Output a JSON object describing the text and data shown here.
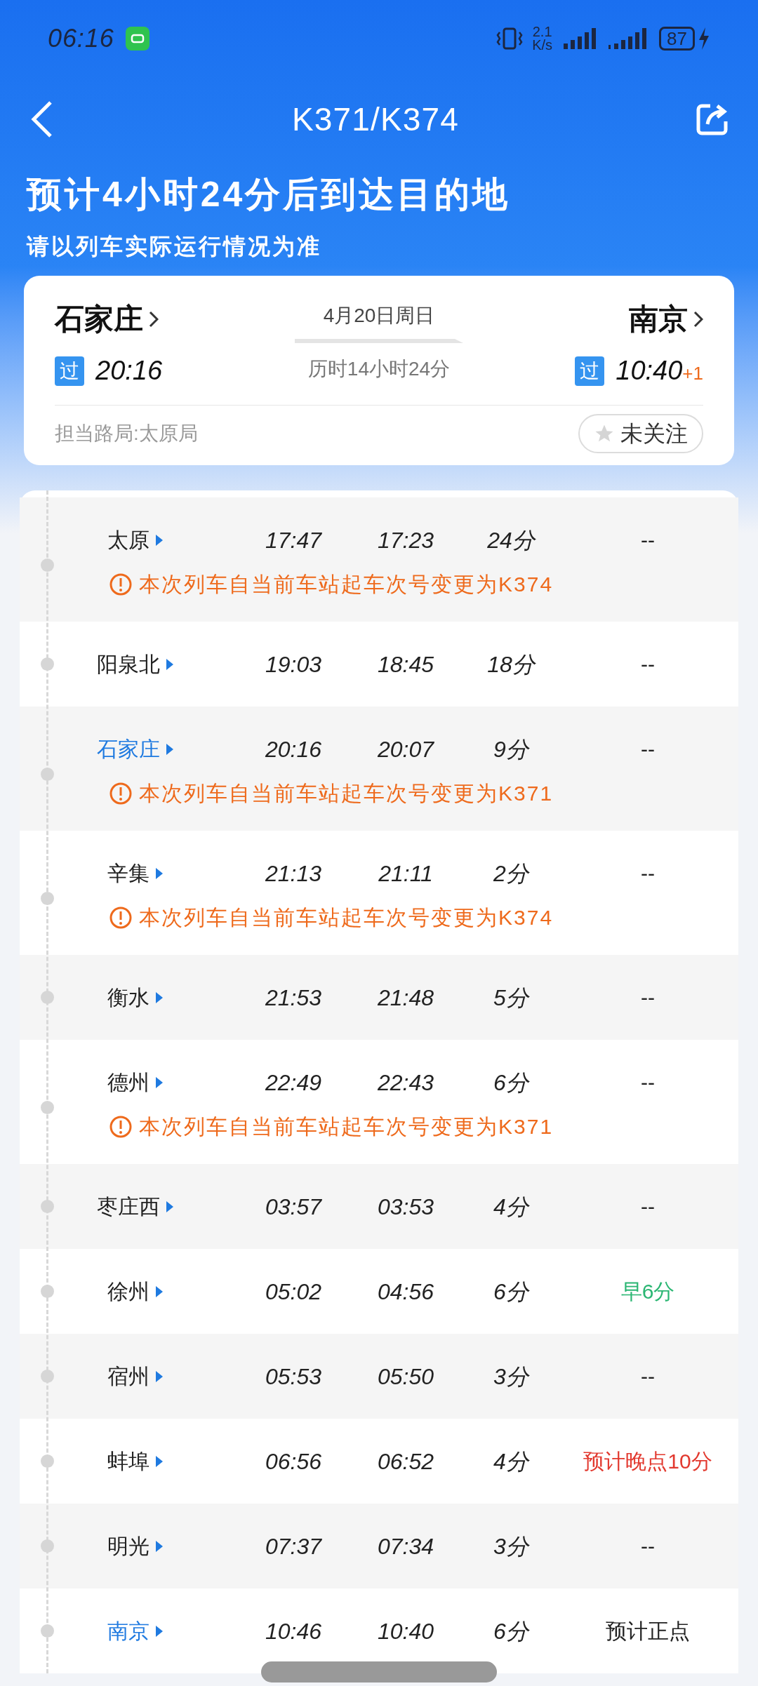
{
  "status_bar": {
    "time": "06:16",
    "net_speed_value": "2.1",
    "net_speed_unit": "K/s",
    "battery": "87"
  },
  "header": {
    "title": "K371/K374"
  },
  "banner": {
    "headline": "预计4小时24分后到达目的地",
    "note": "请以列车实际运行情况为准"
  },
  "trip": {
    "from": "石家庄",
    "from_badge": "过",
    "from_time": "20:16",
    "date": "4月20日周日",
    "duration": "历时14小时24分",
    "to": "南京",
    "to_badge": "过",
    "to_time": "10:40",
    "to_day_offset": "+1",
    "bureau": "担当路局:太原局",
    "follow": {
      "label": "未关注",
      "followed": false
    }
  },
  "stops": [
    {
      "station": "太原",
      "highlighted": false,
      "arrive": "17:47",
      "depart": "17:23",
      "stay": "24分",
      "status": {
        "text": "--",
        "color": "#222222"
      },
      "notice": "本次列车自当前车站起车次号变更为K374"
    },
    {
      "station": "阳泉北",
      "highlighted": false,
      "arrive": "19:03",
      "depart": "18:45",
      "stay": "18分",
      "status": {
        "text": "--",
        "color": "#222222"
      }
    },
    {
      "station": "石家庄",
      "highlighted": true,
      "arrive": "20:16",
      "depart": "20:07",
      "stay": "9分",
      "status": {
        "text": "--",
        "color": "#222222"
      },
      "notice": "本次列车自当前车站起车次号变更为K371"
    },
    {
      "station": "辛集",
      "highlighted": false,
      "arrive": "21:13",
      "depart": "21:11",
      "stay": "2分",
      "status": {
        "text": "--",
        "color": "#222222"
      },
      "notice": "本次列车自当前车站起车次号变更为K374"
    },
    {
      "station": "衡水",
      "highlighted": false,
      "arrive": "21:53",
      "depart": "21:48",
      "stay": "5分",
      "status": {
        "text": "--",
        "color": "#222222"
      }
    },
    {
      "station": "德州",
      "highlighted": false,
      "arrive": "22:49",
      "depart": "22:43",
      "stay": "6分",
      "status": {
        "text": "--",
        "color": "#222222"
      },
      "notice": "本次列车自当前车站起车次号变更为K371"
    },
    {
      "station": "枣庄西",
      "highlighted": false,
      "arrive": "03:57",
      "depart": "03:53",
      "stay": "4分",
      "status": {
        "text": "--",
        "color": "#222222"
      }
    },
    {
      "station": "徐州",
      "highlighted": false,
      "arrive": "05:02",
      "depart": "04:56",
      "stay": "6分",
      "status": {
        "text": "早6分",
        "color": "#2bb673"
      }
    },
    {
      "station": "宿州",
      "highlighted": false,
      "arrive": "05:53",
      "depart": "05:50",
      "stay": "3分",
      "status": {
        "text": "--",
        "color": "#222222"
      }
    },
    {
      "station": "蚌埠",
      "highlighted": false,
      "arrive": "06:56",
      "depart": "06:52",
      "stay": "4分",
      "status": {
        "text": "预计晚点10分",
        "color": "#e2392f"
      }
    },
    {
      "station": "明光",
      "highlighted": false,
      "arrive": "07:37",
      "depart": "07:34",
      "stay": "3分",
      "status": {
        "text": "--",
        "color": "#222222"
      }
    },
    {
      "station": "南京",
      "highlighted": true,
      "arrive": "10:46",
      "depart": "10:40",
      "stay": "6分",
      "status": {
        "text": "预计正点",
        "color": "#222222"
      }
    }
  ]
}
